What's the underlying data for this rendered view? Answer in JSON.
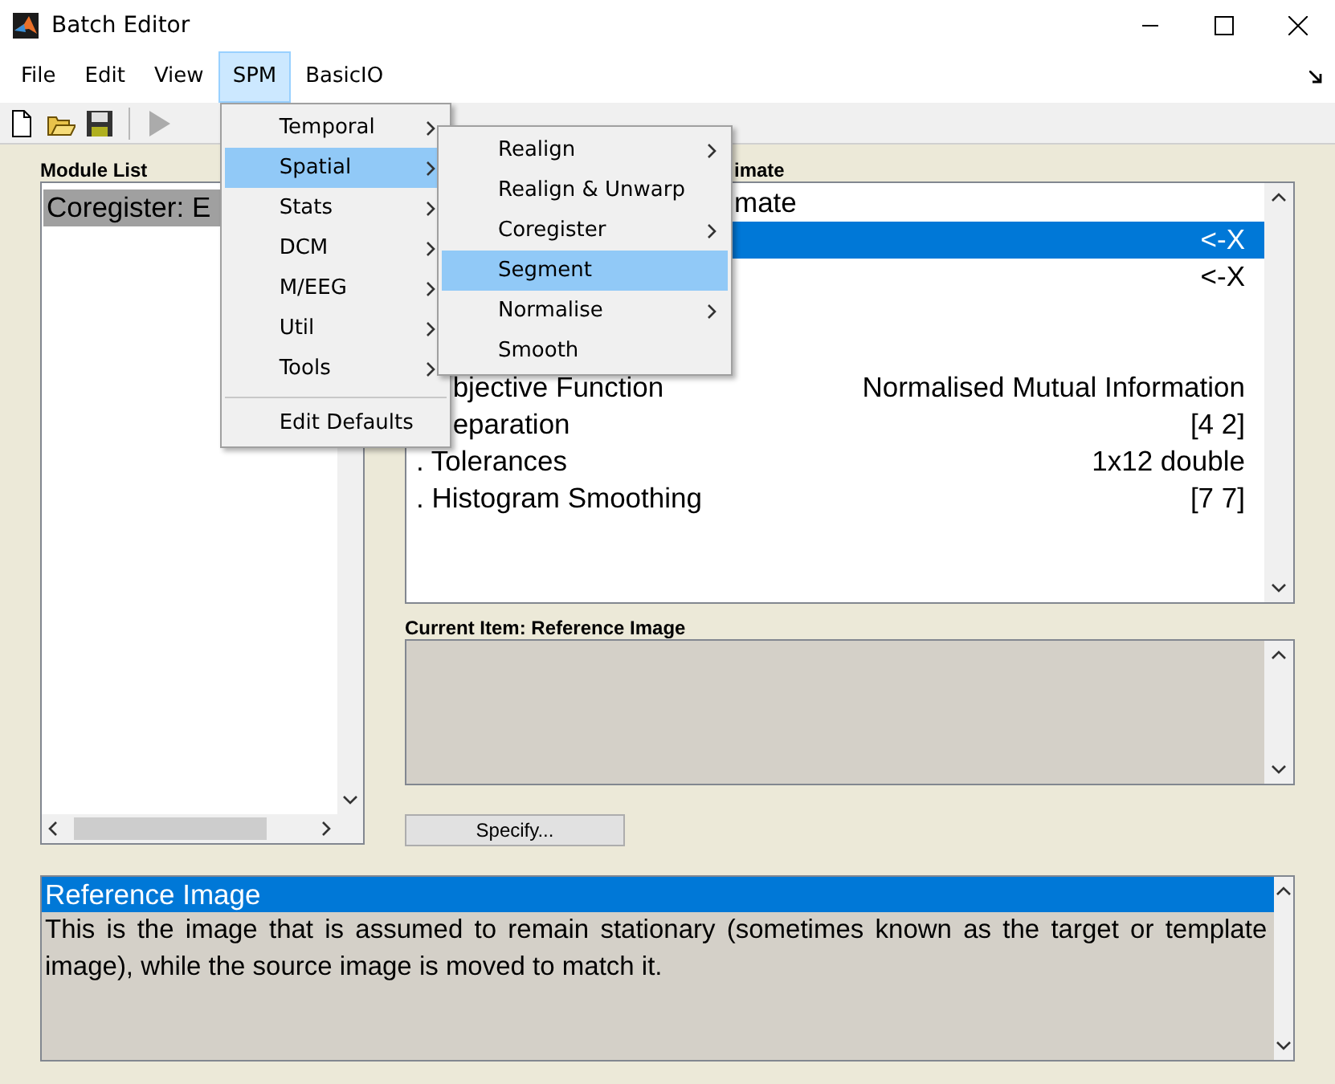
{
  "window": {
    "title": "Batch Editor"
  },
  "menubar": [
    {
      "label": "File",
      "selected": false
    },
    {
      "label": "Edit",
      "selected": false
    },
    {
      "label": "View",
      "selected": false
    },
    {
      "label": "SPM",
      "selected": true
    },
    {
      "label": "BasicIO",
      "selected": false
    }
  ],
  "toolbar": [
    {
      "kind": "new",
      "disabled": false
    },
    {
      "kind": "open",
      "disabled": false
    },
    {
      "kind": "save",
      "disabled": false
    },
    {
      "kind": "run",
      "disabled": true
    }
  ],
  "module_list": {
    "label": "Module List",
    "items": [
      {
        "text": "Coregister: E",
        "selected": true
      }
    ]
  },
  "module_content": {
    "label": {
      "text": "imate"
    },
    "rows": [
      {
        "name": "mate",
        "selected": false
      },
      {
        "value": "<-X",
        "selected": true
      },
      {
        "value": "<-X",
        "selected": false
      },
      {
        "selected": false
      },
      {
        "selected": false
      },
      {
        "name": "bjective Function",
        "value": "Normalised Mutual Information",
        "selected": false
      },
      {
        "name": "eparation",
        "value": "[4 2]",
        "selected": false
      },
      {
        "name": ". Tolerances",
        "value": "1x12 double",
        "selected": false
      },
      {
        "name": ". Histogram Smoothing",
        "value": "[7 7]",
        "selected": false
      }
    ]
  },
  "current_item": {
    "label": "Current Item: Reference Image",
    "button": "Specify..."
  },
  "help": {
    "title": "Reference Image",
    "text": "This is the image that is assumed to remain stationary (sometimes known as the target or template image), while the source image is moved to match it."
  },
  "spm_menu": [
    {
      "label": "Temporal",
      "submenu": true,
      "selected": false
    },
    {
      "label": "Spatial",
      "submenu": true,
      "selected": true
    },
    {
      "label": "Stats",
      "submenu": true,
      "selected": false
    },
    {
      "label": "DCM",
      "submenu": true,
      "selected": false
    },
    {
      "label": "M/EEG",
      "submenu": true,
      "selected": false
    },
    {
      "label": "Util",
      "submenu": true,
      "selected": false
    },
    {
      "label": "Tools",
      "submenu": true,
      "selected": false
    },
    {
      "label": "Edit Defaults",
      "submenu": false,
      "selected": false,
      "separator_before": true
    }
  ],
  "spatial_submenu": [
    {
      "label": "Realign",
      "submenu": true,
      "selected": false
    },
    {
      "label": "Realign & Unwarp",
      "submenu": false,
      "selected": false
    },
    {
      "label": "Coregister",
      "submenu": true,
      "selected": false
    },
    {
      "label": "Segment",
      "submenu": false,
      "selected": true
    },
    {
      "label": "Normalise",
      "submenu": true,
      "selected": false
    },
    {
      "label": "Smooth",
      "submenu": false,
      "selected": false
    }
  ]
}
